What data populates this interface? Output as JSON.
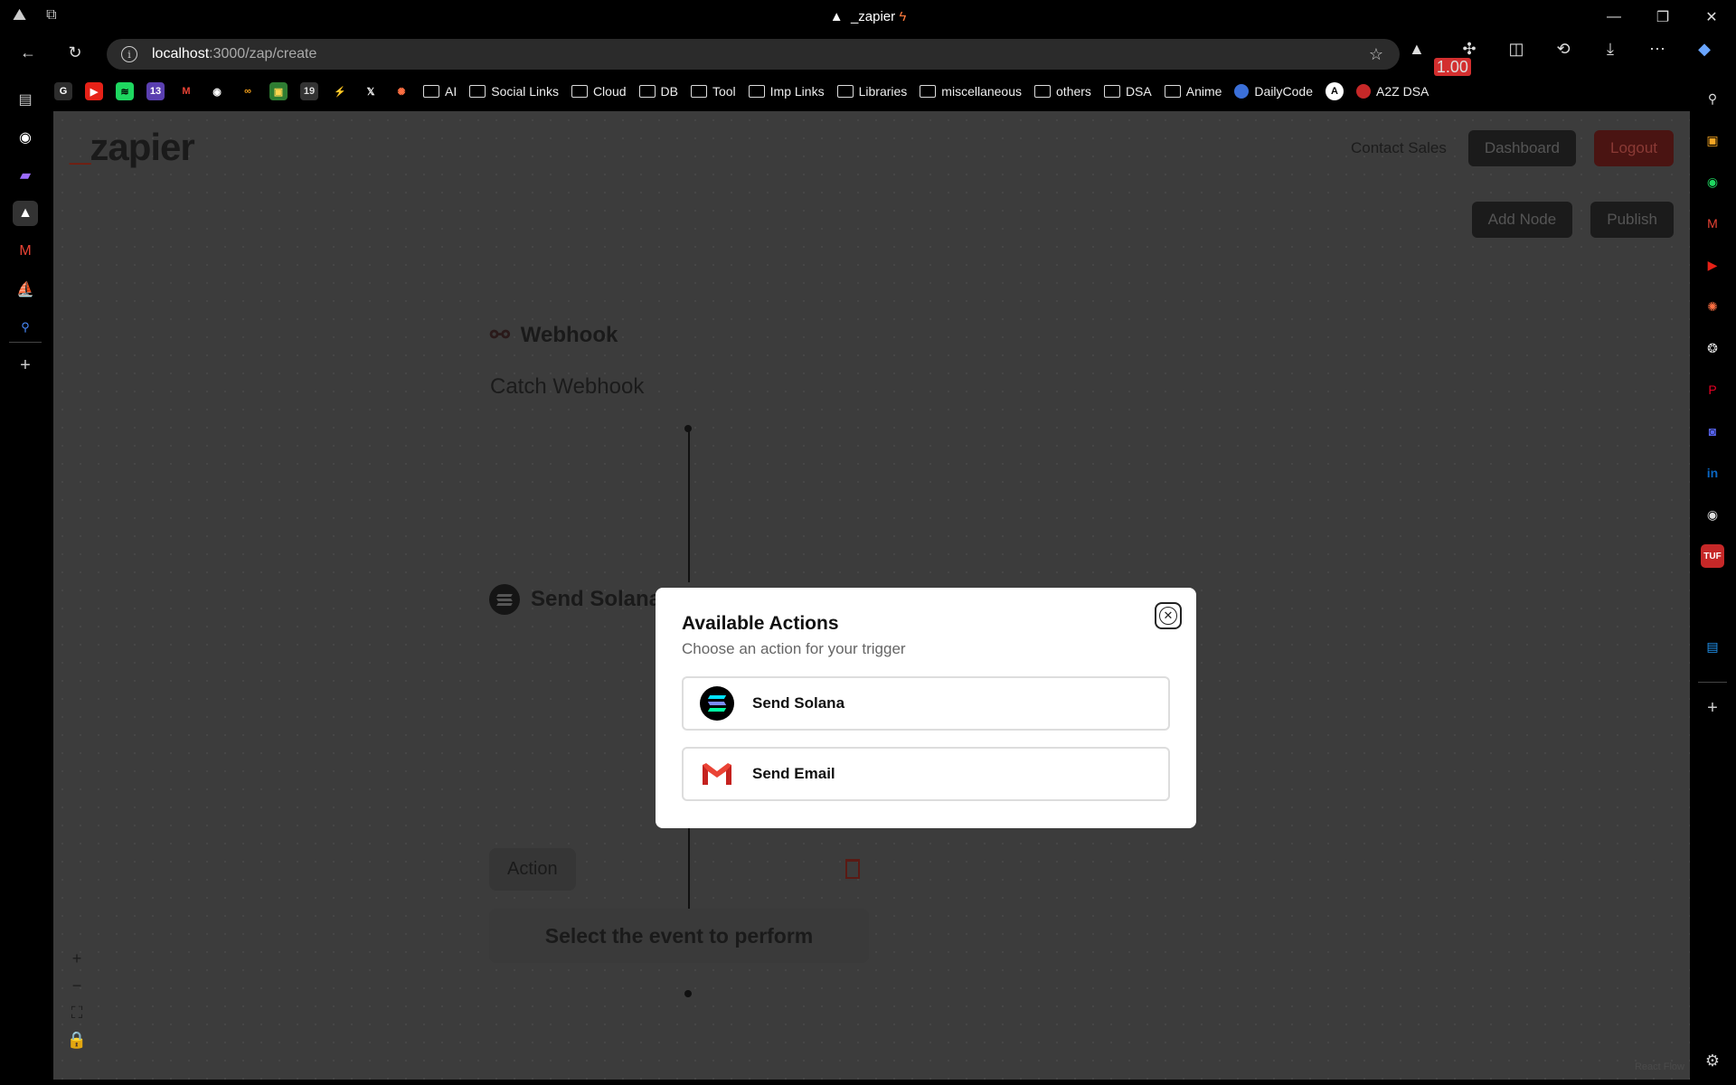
{
  "browser": {
    "tab_title": "_zapier",
    "url_host": "localhost",
    "url_path": ":3000/zap/create",
    "extension_badge": "1.00"
  },
  "bookmarks": [
    {
      "type": "icon",
      "label": "G",
      "color": "#ffffff",
      "bg": "#2d2d2d"
    },
    {
      "type": "icon",
      "label": "▶",
      "color": "#ffffff",
      "bg": "#e62117"
    },
    {
      "type": "icon",
      "label": "≋",
      "color": "#000000",
      "bg": "#1ed760"
    },
    {
      "type": "icon",
      "label": "13",
      "color": "#ffffff",
      "bg": "#5a3fb0"
    },
    {
      "type": "icon",
      "label": "M",
      "color": "#ea4335",
      "bg": "#000000"
    },
    {
      "type": "icon",
      "label": "◉",
      "color": "#ffffff",
      "bg": "#000000"
    },
    {
      "type": "icon",
      "label": "∞",
      "color": "#f8a21a",
      "bg": "#000000"
    },
    {
      "type": "icon",
      "label": "▣",
      "color": "#ffd54f",
      "bg": "#2e7d32"
    },
    {
      "type": "icon",
      "label": "19",
      "color": "#dddddd",
      "bg": "#333333"
    },
    {
      "type": "icon",
      "label": "⚡",
      "color": "#f9a825",
      "bg": "#000000"
    },
    {
      "type": "icon",
      "label": "𝕏",
      "color": "#ffffff",
      "bg": "#000000"
    },
    {
      "type": "icon",
      "label": "✺",
      "color": "#ff7043",
      "bg": "#000000"
    },
    {
      "type": "folder",
      "label": "AI"
    },
    {
      "type": "folder",
      "label": "Social Links"
    },
    {
      "type": "folder",
      "label": "Cloud"
    },
    {
      "type": "folder",
      "label": "DB"
    },
    {
      "type": "folder",
      "label": "Tool"
    },
    {
      "type": "folder",
      "label": "Imp Links"
    },
    {
      "type": "folder",
      "label": "Libraries"
    },
    {
      "type": "folder",
      "label": "miscellaneous"
    },
    {
      "type": "folder",
      "label": "others"
    },
    {
      "type": "folder",
      "label": "DSA"
    },
    {
      "type": "folder",
      "label": "Anime"
    },
    {
      "type": "site",
      "label": "DailyCode"
    },
    {
      "type": "site-icon",
      "label": "A"
    },
    {
      "type": "site",
      "label": "A2Z DSA"
    }
  ],
  "app": {
    "logo_mark": "_",
    "logo_text": "zapier",
    "nav": {
      "contact": "Contact Sales",
      "dashboard": "Dashboard",
      "logout": "Logout"
    },
    "toolbar": {
      "add_node": "Add Node",
      "publish": "Publish"
    },
    "flow": {
      "trigger_title": "Webhook",
      "trigger_event": "Catch Webhook",
      "action1_title": "Send Solana",
      "action2_tag": "Action",
      "action2_prompt": "Select the event to perform"
    },
    "credit": "React Flow"
  },
  "modal": {
    "title": "Available Actions",
    "description": "Choose an action for your trigger",
    "options": [
      {
        "label": "Send Solana",
        "icon": "solana-icon"
      },
      {
        "label": "Send Email",
        "icon": "gmail-icon"
      }
    ]
  },
  "colors": {
    "solana_gradient": [
      "#00ffa3",
      "#03e1ff",
      "#dc1fff"
    ],
    "gmail_red": "#ea4335",
    "logout_red": "#c62828"
  }
}
